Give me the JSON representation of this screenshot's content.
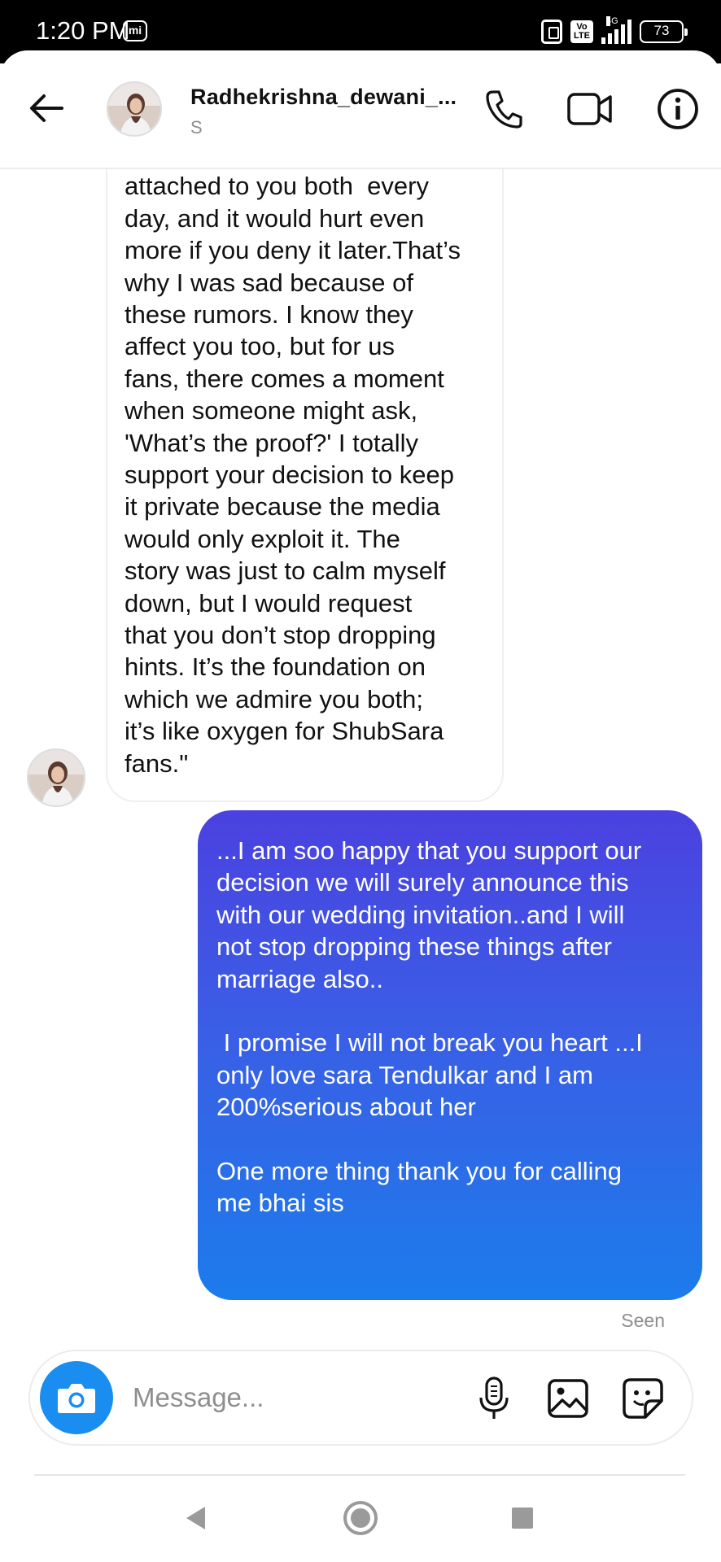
{
  "status_bar": {
    "time": "1:20 PM",
    "mi_label": "mi",
    "volte_label": "Vo LTE",
    "network": "4G",
    "battery": "73"
  },
  "header": {
    "username": "Radhekrishna_dewani_...",
    "subtitle": "S",
    "icons": [
      "back-arrow-icon",
      "phone-icon",
      "video-camera-icon",
      "info-icon"
    ]
  },
  "messages": [
    {
      "direction": "incoming",
      "text": "attached to you both  every\nday, and it would hurt even\nmore if you deny it later.That’s\nwhy I was sad because of\nthese rumors. I know they\naffect you too, but for us\nfans, there comes a moment\nwhen someone might ask,\n'What’s the proof?' I totally\nsupport your decision to keep\nit private because the media\nwould only exploit it. The\nstory was just to calm myself\ndown, but I would request\nthat you don’t stop dropping\nhints. It’s the foundation on\nwhich we admire you both;\nit’s like oxygen for ShubSara\nfans.\""
    },
    {
      "direction": "outgoing",
      "text": "...I am soo happy that you support our\ndecision we will surely announce this\nwith our wedding invitation..and I will\nnot stop dropping these things after\nmarriage also..\n\n I promise I will not break you heart ...I\nonly love sara Tendulkar and I am\n200%serious about her\n\nOne more thing thank you for calling\nme bhai sis"
    }
  ],
  "seen_label": "Seen",
  "composer": {
    "placeholder": "Message...",
    "icons": [
      "camera-icon",
      "microphone-icon",
      "gallery-icon",
      "sticker-icon"
    ]
  },
  "colors": {
    "outgoing_gradient_top": "#4b41e0",
    "outgoing_gradient_bottom": "#1c7cec",
    "camera_button": "#1a8ef0"
  }
}
